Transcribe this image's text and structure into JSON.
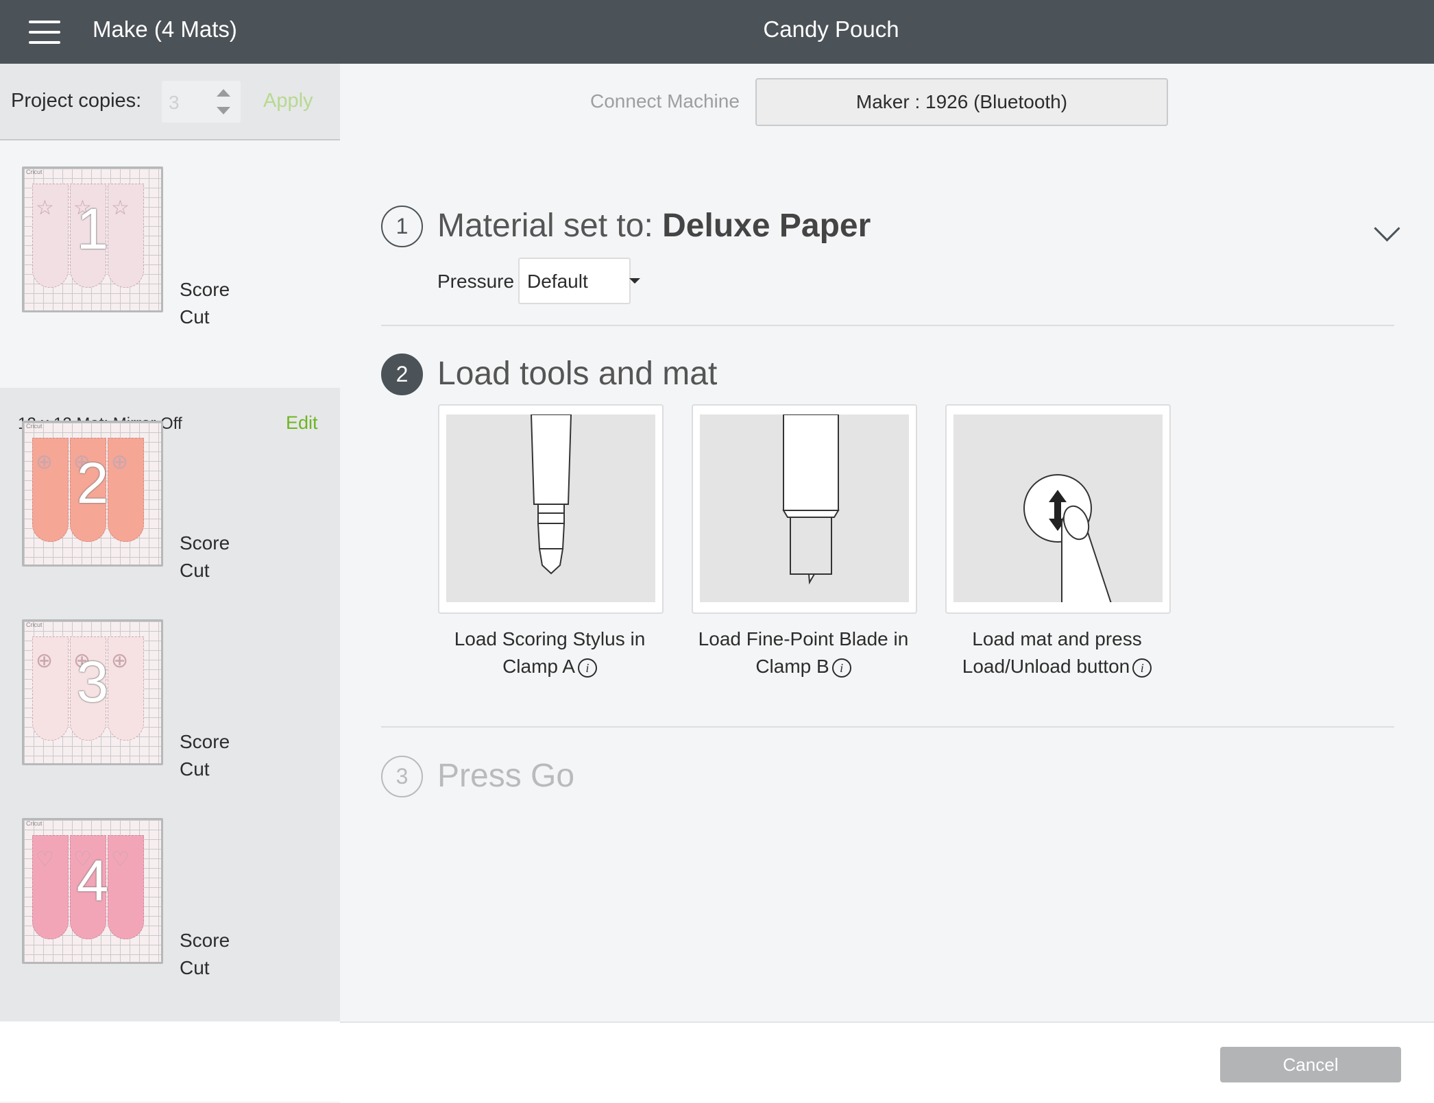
{
  "header": {
    "make_title": "Make (4 Mats)",
    "project_title": "Candy Pouch"
  },
  "sidebar": {
    "copies_label": "Project copies:",
    "copies_value": "3",
    "apply_label": "Apply",
    "mats": [
      {
        "number": "1",
        "ops": [
          "Score",
          "Cut"
        ],
        "info": "12 x 12 Mat; Mirror Off",
        "edit_label": "Edit",
        "color": "#f1dfe3",
        "mark": "☆"
      },
      {
        "number": "2",
        "ops": [
          "Score",
          "Cut"
        ],
        "color": "#f6a695",
        "mark": "⊕"
      },
      {
        "number": "3",
        "ops": [
          "Score",
          "Cut"
        ],
        "color": "#f7e2e3",
        "mark": "⊕"
      },
      {
        "number": "4",
        "ops": [
          "Score",
          "Cut"
        ],
        "color": "#f3a5b8",
        "mark": "♡"
      }
    ],
    "thumb_brand": "Cricut"
  },
  "machine": {
    "connect_label": "Connect Machine",
    "machine_name": "Maker : 1926 (Bluetooth)"
  },
  "steps": {
    "s1": {
      "num": "1",
      "title_prefix": "Material set to: ",
      "material": "Deluxe Paper",
      "pressure_label": "Pressure",
      "pressure_value": "Default"
    },
    "s2": {
      "num": "2",
      "title": "Load tools and mat",
      "cards": [
        {
          "line1": "Load Scoring Stylus in",
          "line2": "Clamp A"
        },
        {
          "line1": "Load Fine-Point Blade in",
          "line2": "Clamp B"
        },
        {
          "line1": "Load mat and press",
          "line2": "Load/Unload button"
        }
      ],
      "info_glyph": "i"
    },
    "s3": {
      "num": "3",
      "title": "Press Go"
    }
  },
  "footer": {
    "cancel_label": "Cancel"
  },
  "colors": {
    "header_bg": "#4b5258",
    "accent_green": "#6fb520",
    "apply_disabled": "#b7d98f"
  }
}
